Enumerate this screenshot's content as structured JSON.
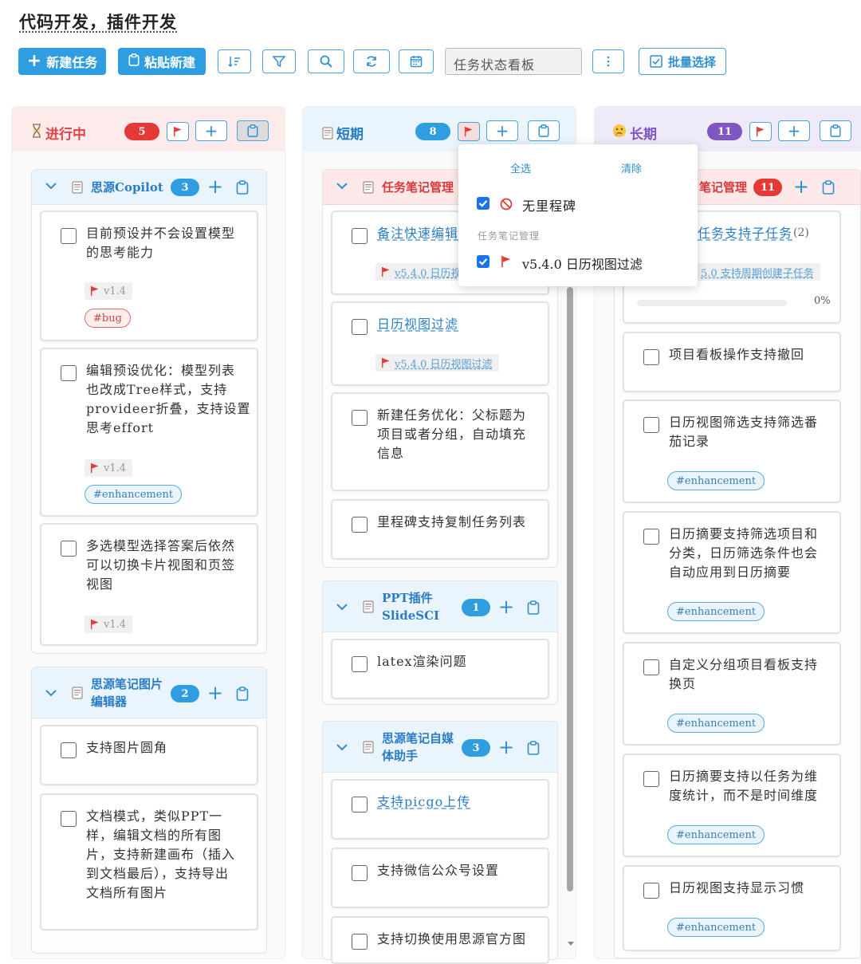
{
  "page_title": "代码开发，插件开发",
  "toolbar": {
    "new_task": "新建任务",
    "paste_new": "粘贴新建",
    "view_select": "任务状态看板",
    "batch_select": "批量选择"
  },
  "colors": {
    "accent": "#2f9ee0",
    "red": "#e53935",
    "purple": "#7e57c2"
  },
  "columns": [
    {
      "title": "进行中",
      "icon": "hourglass-icon",
      "count": "5"
    },
    {
      "title": "短期",
      "icon": "document-icon",
      "count": "8"
    },
    {
      "title": "长期",
      "icon": "thinking-face-icon",
      "count": "11"
    }
  ],
  "popover": {
    "select_all": "全选",
    "clear": "清除",
    "item_none": "无里程碑",
    "section": "任务笔记管理",
    "item_milestone": "v5.4.0 日历视图过滤"
  },
  "col1": {
    "group1": {
      "title": "思源Copilot",
      "count": "3"
    },
    "card1": {
      "line1": "目前预设并不会设置模型",
      "line2": "的思考能力",
      "version": "v1.4",
      "tag": "#bug"
    },
    "card2": {
      "line1": "编辑预设优化：模型列表",
      "line2": "也改成Tree样式，支持",
      "line3": "provideer折叠，支持设置",
      "line4": "思考effort",
      "version": "v1.4",
      "tag": "#enhancement"
    },
    "card3": {
      "line1": "多选模型选择答案后依然",
      "line2": "可以切换卡片视图和页签",
      "line3": "视图",
      "version": "v1.4"
    },
    "group2": {
      "title_line1": "思源笔记图片",
      "title_line2": "编辑器",
      "count": "2"
    },
    "card4": {
      "line1": "支持图片圆角"
    },
    "card5": {
      "line1": "文档模式，类似PPT一",
      "line2": "样，编辑文档的所有图",
      "line3": "片，支持新建画布（插入",
      "line4": "到文档最后），支持导出",
      "line5": "文档所有图片"
    }
  },
  "col2": {
    "group1": {
      "title": "任务笔记管理"
    },
    "card1": {
      "line1": "备注快速编辑",
      "version": "v5.4.0 日历视"
    },
    "card2": {
      "line1": "日历视图过滤",
      "version": "v5.4.0 日历视图过滤"
    },
    "card3": {
      "line1": "新建任务优化：父标题为",
      "line2": "项目或者分组，自动填充",
      "line3": "信息"
    },
    "card4": {
      "line1": "里程碑支持复制任务列表"
    },
    "group2": {
      "title_line1": "PPT插件",
      "title_line2": "SlideSCI",
      "count": "1"
    },
    "card5": {
      "line1": "latex渲染问题"
    },
    "group3": {
      "title_line1": "思源笔记自媒",
      "title_line2": "体助手",
      "count": "3"
    },
    "card6": {
      "line1": "支持picgo上传"
    },
    "card7": {
      "line1": "支持微信公众号设置"
    },
    "card8": {
      "line1": "支持切换使用思源官方图"
    }
  },
  "col3": {
    "group1": {
      "title": "笔记管理",
      "count": "11"
    },
    "card1": {
      "line1": "任务支持子任务",
      "sub": "(2)",
      "version": "5.0 支持周期创建子任务",
      "progress": "0%"
    },
    "card2": {
      "line1": "项目看板操作支持撤回"
    },
    "card3": {
      "line1": "日历视图筛选支持筛选番",
      "line2": "茄记录",
      "tag": "#enhancement"
    },
    "card4": {
      "line1": "日历摘要支持筛选项目和",
      "line2": "分类，日历筛选条件也会",
      "line3": "自动应用到日历摘要",
      "tag": "#enhancement"
    },
    "card5": {
      "line1": "自定义分组项目看板支持",
      "line2": "换页",
      "tag": "#enhancement"
    },
    "card6": {
      "line1": "日历摘要支持以任务为维",
      "line2": "度统计，而不是时间维度",
      "tag": "#enhancement"
    },
    "card7": {
      "line1": "日历视图支持显示习惯",
      "tag": "#enhancement"
    }
  }
}
